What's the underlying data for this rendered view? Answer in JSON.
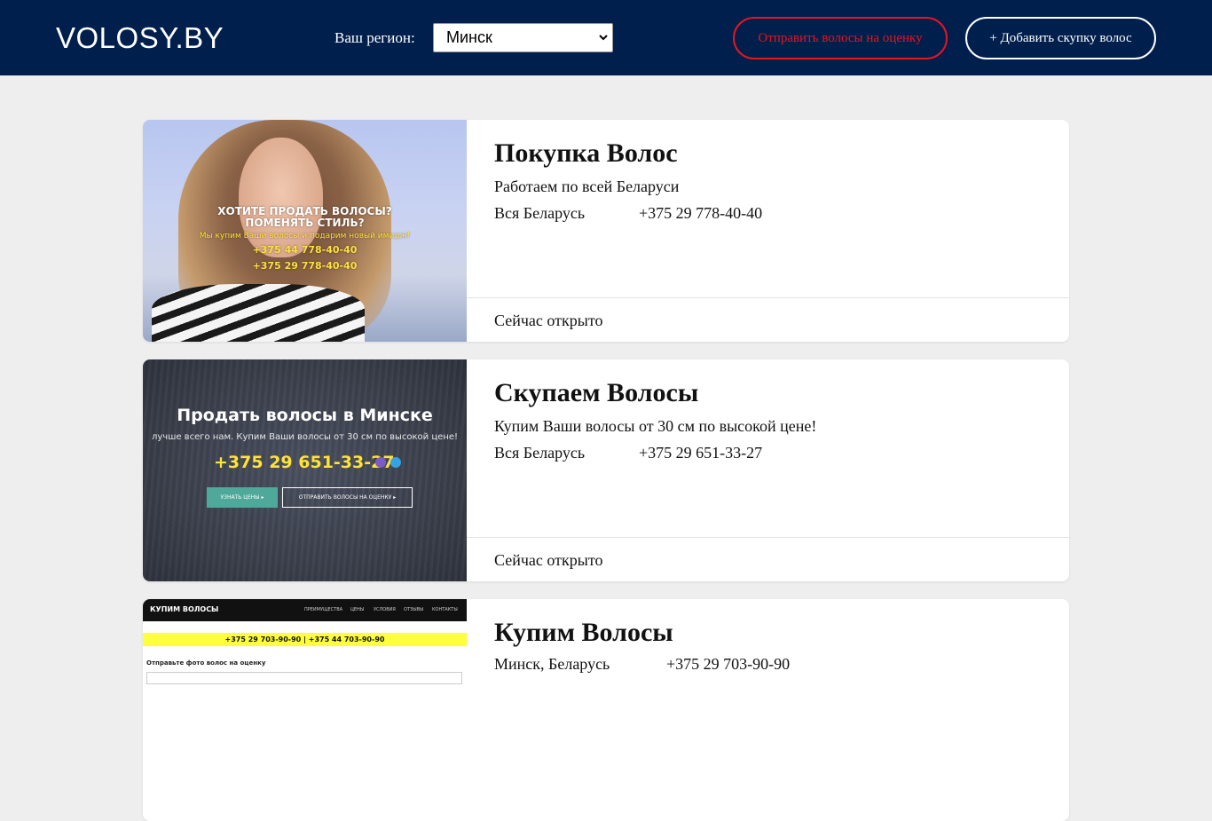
{
  "header": {
    "logo": "VOLOSY.BY",
    "region_label": "Ваш регион:",
    "region_selected": "Минск",
    "evaluate_button": "Отправить волосы на оценку",
    "add_button": "+ Добавить скупку волос",
    "colors": {
      "bg": "#001f4d",
      "accent_red": "#e8141e"
    }
  },
  "listings": [
    {
      "title": "Покупка Волос",
      "description": "Работаем по всей Беларуси",
      "location": "Вся Беларусь",
      "phone": "+375 29 778-40-40",
      "status": "Сейчас открыто",
      "thumb": {
        "line1": "ХОТИТЕ ПРОДАТЬ ВОЛОСЫ?",
        "line2": "ПОМЕНЯТЬ СТИЛЬ?",
        "line3": "Мы купим Ваши волосы и подарим новый имидж!",
        "phone1": "+375 44 778-40-40",
        "phone2": "+375 29 778-40-40"
      }
    },
    {
      "title": "Скупаем Волосы",
      "description": "Купим Ваши волосы от 30 см по высокой цене!",
      "location": "Вся Беларусь",
      "phone": "+375 29 651-33-27",
      "status": "Сейчас открыто",
      "thumb": {
        "title": "Продать волосы в Минске",
        "subtitle": "лучше всего нам. Купим Ваши волосы от 30 см по высокой цене!",
        "phone": "+375 29 651-33-27",
        "btn_prices": "УЗНАТЬ ЦЕНЫ ▸",
        "btn_evaluate": "ОТПРАВИТЬ ВОЛОСЫ НА ОЦЕНКУ ▸"
      }
    },
    {
      "title": "Купим Волосы",
      "location": "Минск, Беларусь",
      "phone": "+375 29 703-90-90",
      "thumb": {
        "brand": "КУПИМ ВОЛОСЫ",
        "nav": [
          "ПРЕИМУЩЕСТВА",
          "ЦЕНЫ",
          "УСЛОВИЯ",
          "ОТЗЫВЫ",
          "КОНТАКТЫ"
        ],
        "phones": "+375 29 703-90-90   |   +375 44 703-90-90",
        "form_title": "Отправьте фото волос на оценку"
      }
    }
  ]
}
